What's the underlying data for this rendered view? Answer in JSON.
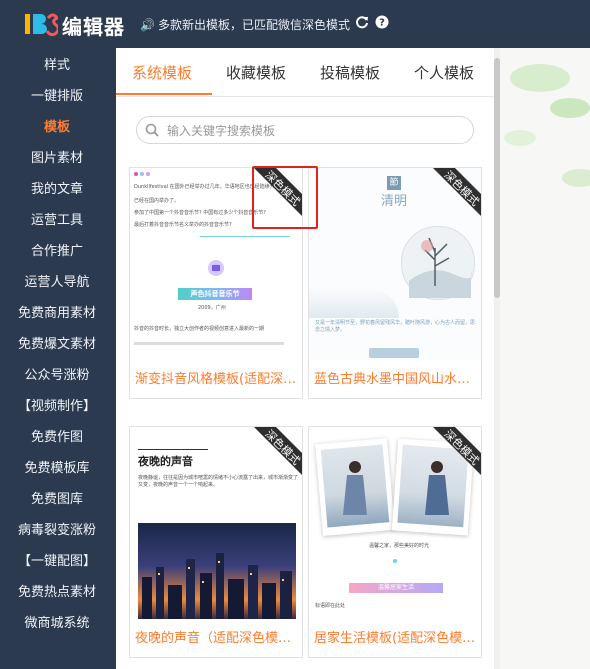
{
  "header": {
    "logo_text": "编辑器",
    "notice": "多款新出模板，已匹配微信深色模式"
  },
  "sidebar": {
    "items": [
      {
        "label": "样式"
      },
      {
        "label": "一键排版"
      },
      {
        "label": "模板"
      },
      {
        "label": "图片素材"
      },
      {
        "label": "我的文章"
      },
      {
        "label": "运营工具"
      },
      {
        "label": "合作推广"
      },
      {
        "label": "运营人导航"
      },
      {
        "label": "免费商用素材"
      },
      {
        "label": "免费爆文素材"
      },
      {
        "label": "公众号涨粉"
      },
      {
        "label": "【视频制作】"
      },
      {
        "label": "免费作图"
      },
      {
        "label": "免费模板库"
      },
      {
        "label": "免费图库"
      },
      {
        "label": "病毒裂变涨粉"
      },
      {
        "label": "【一键配图】"
      },
      {
        "label": "免费热点素材"
      },
      {
        "label": "微商城系统"
      }
    ],
    "active_index": 2
  },
  "tabs": [
    {
      "label": "系统模板"
    },
    {
      "label": "收藏模板"
    },
    {
      "label": "投稿模板"
    },
    {
      "label": "个人模板"
    }
  ],
  "search": {
    "placeholder": "输入关键字搜索模板"
  },
  "ribbon_label": "深色模式",
  "templates": [
    {
      "title": "渐变抖音风格模板(适配深色模式)",
      "preview_lines": [
        "Dunkllfestival 在国外已经举办过几年，华语地区也已经陆续开展",
        "已经在国内举办了。",
        "参加了中国第一个抖音音乐节? 中国有过多少个抖音音乐节?",
        "最后打着抖音音乐节名义举办的抖音音乐节?",
        "2009，广州",
        "抖音的抖音时长，独立大创作者的视频创意进入最新的一期"
      ],
      "preview_banner": "声色抖音音乐节"
    },
    {
      "title": "蓝色古典水墨中国风山水模板",
      "preview_badge": "節",
      "preview_heading": "清明",
      "preview_lines": [
        "又是一年清明节至，野花春风留残风华，踏叶随风游，心为古人而留，思念之情入梦。"
      ]
    },
    {
      "title": "夜晚的声音（适配深色模式）",
      "preview_heading": "夜晚的声音",
      "preview_lines": [
        "夜晚静谧，往往是因为城市喧嚣的情绪不小心流露了出来，城市渐渐变了又变，夜晚的声音一个一个响起来。"
      ]
    },
    {
      "title": "居家生活模板(适配深色模式)",
      "preview_lines": [
        "温馨之家，那些美好的时光",
        "标语即在此处"
      ],
      "preview_banner": "温馨居家生活"
    }
  ],
  "colors": {
    "sidebar_bg": "#2b3a4f",
    "accent": "#ff7c2e",
    "highlight": "#e0241c"
  }
}
